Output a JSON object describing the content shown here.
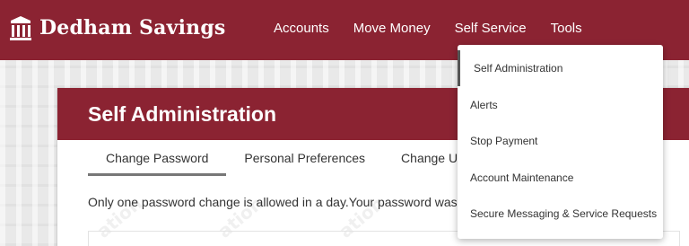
{
  "brand": {
    "name": "Dedham Savings",
    "color": "#8b2332"
  },
  "nav": {
    "items": [
      "Accounts",
      "Move Money",
      "Self Service",
      "Tools"
    ]
  },
  "page": {
    "title": "Self Administration",
    "tabs": [
      "Change Password",
      "Personal Preferences",
      "Change Use"
    ],
    "active_tab": "Change Password",
    "notice": "Only one password change is allowed in a day.Your password was las",
    "watermark": "ation"
  },
  "dropdown": {
    "parent": "Self Service",
    "items": [
      "Self Administration",
      "Alerts",
      "Stop Payment",
      "Account Maintenance",
      "Secure Messaging & Service Requests"
    ],
    "selected": "Self Administration"
  }
}
